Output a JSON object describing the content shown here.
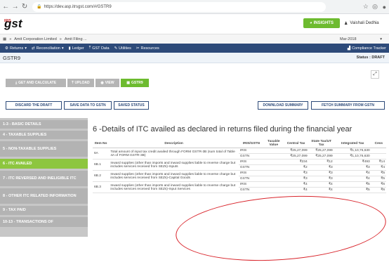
{
  "browser": {
    "url": "https://dev.asp.itrsgst.com/#/GSTR9"
  },
  "header": {
    "logo_small": "IRIS",
    "logo_main": "gst",
    "insights_label": "INSIGHTS",
    "user_name": "Vaishali Dedhia"
  },
  "breadcrumb": {
    "items": [
      "Amit Corporation Limited",
      "Amit Filing ..."
    ],
    "period": "Mar-2018"
  },
  "menu": {
    "items": [
      "Returns",
      "Reconciliation",
      "Ledger",
      "GST Data",
      "Utilities",
      "Resources"
    ],
    "tracker": "Compliance Tracker"
  },
  "page": {
    "title": "GSTR9",
    "status": "Status : DRAFT"
  },
  "actions": {
    "get_calc": "GET AND CALCULATE",
    "upload": "UPLOAD",
    "view": "VIEW",
    "gstr9": "GSTR9"
  },
  "outline_buttons": {
    "discard": "DISCARD THE DRAFT",
    "save": "SAVE DATA TO GSTN",
    "saved_status": "SAVED STATUS",
    "download": "DOWNLOAD SUMMARY",
    "fetch": "FETCH SUMMARY FROM GSTN"
  },
  "sidebar": {
    "items": [
      {
        "label": "1-3 - BASIC DETAILS"
      },
      {
        "label": "4 - TAXABLE SUPPLIES"
      },
      {
        "label": "5 - NON-TAXABLE SUPPLIES"
      },
      {
        "label": "6 - ITC AVAILED"
      },
      {
        "label": "7 - ITC REVERSED AND INELIGIBLE ITC"
      },
      {
        "label": "8 - OTHER ITC RELATED INFORMATION"
      },
      {
        "label": "9 - TAX PAID"
      },
      {
        "label": "10-13 - TRANSACTIONS OF"
      }
    ]
  },
  "section": {
    "title": "6 -Details of ITC availed as declared in returns filed during the financial year"
  },
  "table": {
    "headers": [
      "Item No",
      "Description",
      "IRIS/GSTN",
      "Taxable Value",
      "Central Tax",
      "State Tax/UT Tax",
      "Integrated Tax",
      "Cess"
    ],
    "rows": [
      {
        "item": "6A",
        "desc": "Total amount of input tax credit availed through FORM GSTR-3B (sum total of Table 4A of FORM GSTR-3B)",
        "src": "IRIS",
        "taxable": "",
        "central": "₹25,27,099",
        "state": "₹25,27,099",
        "integrated": "₹1,10,76,630",
        "cess": ""
      },
      {
        "item": "",
        "desc": "",
        "src": "GSTN",
        "taxable": "",
        "central": "₹25,27,099",
        "state": "₹25,27,099",
        "integrated": "₹1,10,76,630",
        "cess": ""
      },
      {
        "item": "6B.1",
        "desc": "Inward supplies (other than imports and inward supplies liable to reverse charge but includes services received from SEZs)-Inputs",
        "src": "IRIS",
        "taxable": "",
        "central": "₹234",
        "state": "₹12",
        "integrated": "₹493",
        "cess": "₹14"
      },
      {
        "item": "",
        "desc": "",
        "src": "GSTN",
        "taxable": "",
        "central": "₹2",
        "state": "₹3",
        "integrated": "₹3",
        "cess": "₹4"
      },
      {
        "item": "6B.2",
        "desc": "Inward supplies (other than imports and inward supplies liable to reverse charge but includes services received from SEZs)-Capital Goods",
        "src": "IRIS",
        "taxable": "",
        "central": "₹3",
        "state": "₹3",
        "integrated": "₹4",
        "cess": "₹5"
      },
      {
        "item": "",
        "desc": "",
        "src": "GSTN",
        "taxable": "",
        "central": "₹3",
        "state": "₹3",
        "integrated": "₹4",
        "cess": "₹5"
      },
      {
        "item": "6B.3",
        "desc": "Inward supplies (other than imports and inward supplies liable to reverse charge but includes services received from SEZs)-Input Services",
        "src": "IRIS",
        "taxable": "",
        "central": "₹4",
        "state": "₹4",
        "integrated": "₹5",
        "cess": "₹6"
      },
      {
        "item": "",
        "desc": "",
        "src": "GSTN",
        "taxable": "",
        "central": "₹4",
        "state": "₹4",
        "integrated": "₹5",
        "cess": "₹6"
      }
    ]
  },
  "colors": {
    "navy": "#2d4a79",
    "green": "#8dc63f",
    "annotation": "#d9252c"
  }
}
